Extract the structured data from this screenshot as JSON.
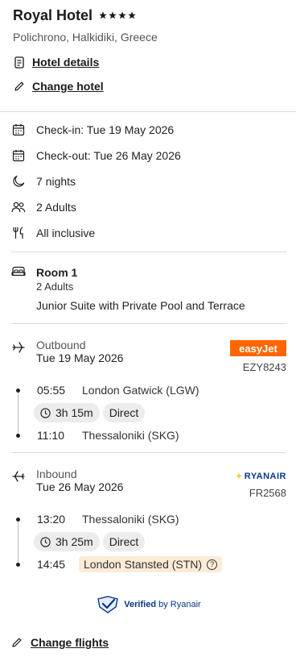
{
  "hotel": {
    "name": "Royal Hotel",
    "stars": 4,
    "location": "Polichrono, Halkidiki, Greece",
    "details_link": "Hotel details",
    "change_link": "Change hotel"
  },
  "stay": {
    "check_in": "Check-in: Tue 19 May 2026",
    "check_out": "Check-out: Tue 26 May 2026",
    "nights": "7 nights",
    "guests": "2 Adults",
    "board": "All inclusive"
  },
  "room": {
    "title": "Room 1",
    "guests": "2 Adults",
    "description": "Junior Suite with Private Pool and Terrace"
  },
  "outbound": {
    "label": "Outbound",
    "date": "Tue 19 May 2026",
    "carrier_logo": "easyJet",
    "flight_number": "EZY8243",
    "depart_time": "05:55",
    "depart_airport": "London Gatwick (LGW)",
    "duration": "3h 15m",
    "stops": "Direct",
    "arrive_time": "11:10",
    "arrive_airport": "Thessaloniki (SKG)"
  },
  "inbound": {
    "label": "Inbound",
    "date": "Tue 26 May 2026",
    "carrier_logo": "RYANAIR",
    "flight_number": "FR2568",
    "depart_time": "13:20",
    "depart_airport": "Thessaloniki (SKG)",
    "duration": "3h 25m",
    "stops": "Direct",
    "arrive_time": "14:45",
    "arrive_airport": "London Stansted (STN)"
  },
  "verified": {
    "strong": "Verified",
    "rest": " by Ryanair"
  },
  "actions": {
    "change_flights": "Change flights"
  },
  "colors": {
    "easyjet": "#ff6600",
    "ryanair_blue": "#073590",
    "highlight": "#fdebd6",
    "pill": "#ececec"
  }
}
